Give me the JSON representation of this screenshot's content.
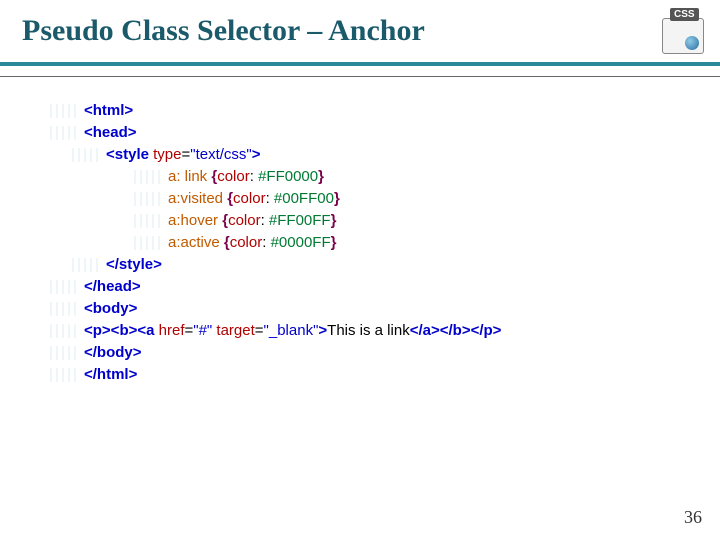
{
  "title": "Pseudo Class Selector – Anchor",
  "logo_badge": "CSS",
  "page_number": "36",
  "code": {
    "html_open": "<html>",
    "head_open": "<head>",
    "style_open_tag": "<style",
    "style_attr_name": " type",
    "style_attr_eq": "=",
    "style_attr_val": "\"text/css\"",
    "style_open_close": ">",
    "rules": [
      {
        "selector": "a: link",
        "prop": "color",
        "value": "#FF0000"
      },
      {
        "selector": "a:visited",
        "prop": "color",
        "value": "#00FF00"
      },
      {
        "selector": "a:hover",
        "prop": "color",
        "value": "#FF00FF"
      },
      {
        "selector": "a:active",
        "prop": "color",
        "value": "#0000FF"
      }
    ],
    "style_close": "</style>",
    "head_close": "</head>",
    "body_open": "<body>",
    "para": {
      "prefix": "<p><b><a",
      "href_name": " href",
      "href_val": "\"#\"",
      "target_name": " target",
      "target_val": "\"_blank\"",
      "mid": ">",
      "link_text": "This is a link",
      "suffix": "</a></b></p>"
    },
    "body_close": "</body>",
    "html_close": "</html>"
  }
}
